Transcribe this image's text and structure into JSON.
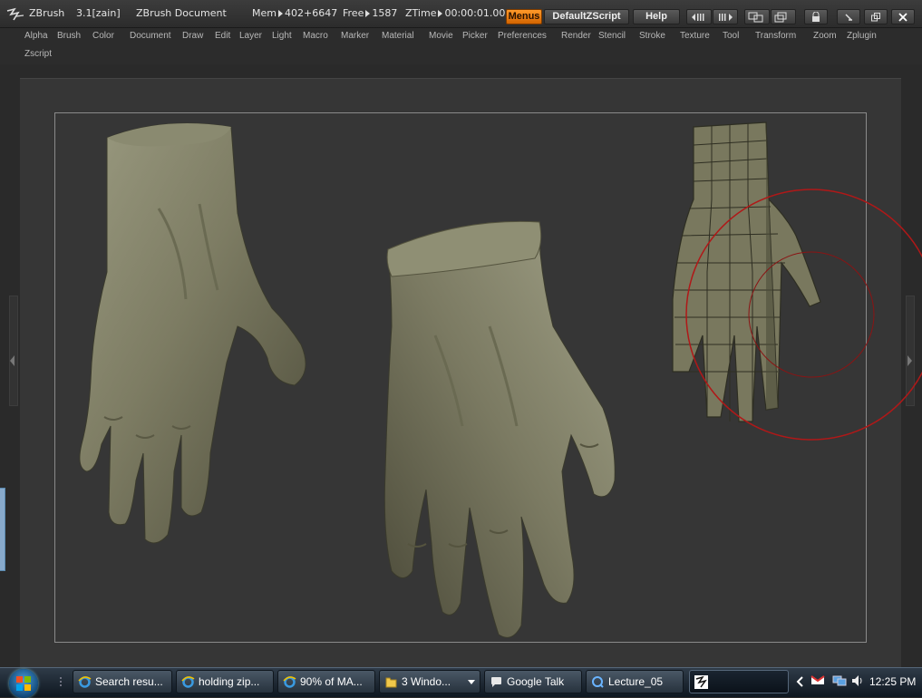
{
  "window": {
    "app_title": "ZBrush",
    "version": "3.1[zain]",
    "document": "ZBrush Document",
    "mem_label": "Mem",
    "mem_value": "402+6647",
    "free_label": "Free",
    "free_value": "1587",
    "ztime_label": "ZTime",
    "ztime_value": "00:00:01.00",
    "buttons": {
      "menus": "Menus",
      "defaultzscript": "DefaultZScript",
      "help": "Help"
    }
  },
  "menubar": {
    "items": [
      "Alpha",
      "Brush",
      "Color",
      "Document",
      "Draw",
      "Edit",
      "Layer",
      "Light",
      "Macro",
      "Marker",
      "Material",
      "Movie",
      "Picker",
      "Preferences",
      "Render",
      "Stencil",
      "Stroke",
      "Texture",
      "Tool",
      "Transform",
      "Zoom",
      "Zplugin",
      "Zscript"
    ]
  },
  "canvas": {
    "subjects": [
      "sculpted-hand-left",
      "sculpted-hand-center",
      "wireframe-hand-mesh"
    ],
    "material_color": "#7d7c63",
    "brush_cursor_color": "#b01818"
  },
  "taskbar": {
    "tasks": [
      {
        "label": "Search resu...",
        "icon": "ie-icon"
      },
      {
        "label": "holding zip...",
        "icon": "ie-icon"
      },
      {
        "label": "90% of MA...",
        "icon": "ie-icon"
      },
      {
        "label": "3 Windo...",
        "icon": "folder-icon"
      },
      {
        "label": "Google Talk",
        "icon": "chat-icon"
      },
      {
        "label": "Lecture_05",
        "icon": "quicktime-icon"
      },
      {
        "label": "",
        "icon": "zbrush-icon"
      }
    ],
    "clock": "12:25 PM"
  }
}
